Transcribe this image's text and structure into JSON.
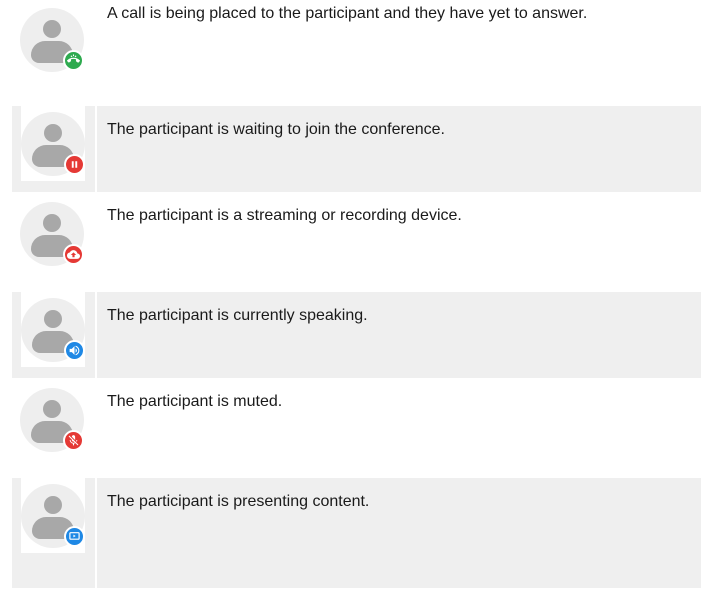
{
  "colors": {
    "row_shaded": "#efefef",
    "avatar_bg": "#eeeeee",
    "avatar_figure": "#a8a8a8",
    "badge_green": "#2eaa4f",
    "badge_red": "#e53935",
    "badge_blue": "#1e88e5"
  },
  "rows": [
    {
      "description": "A call is being placed to the participant and they have yet to answer.",
      "badge_icon": "ringing-phone-icon",
      "badge_color": "#2eaa4f",
      "shaded": false
    },
    {
      "description": "The participant is waiting to join the conference.",
      "badge_icon": "pause-icon",
      "badge_color": "#e53935",
      "shaded": true
    },
    {
      "description": "The participant is a streaming or recording device.",
      "badge_icon": "cloud-upload-icon",
      "badge_color": "#e53935",
      "shaded": false
    },
    {
      "description": "The participant is currently speaking.",
      "badge_icon": "speaker-icon",
      "badge_color": "#1e88e5",
      "shaded": true
    },
    {
      "description": "The participant is muted.",
      "badge_icon": "mic-off-icon",
      "badge_color": "#e53935",
      "shaded": false
    },
    {
      "description": "The participant is presenting content.",
      "badge_icon": "presentation-icon",
      "badge_color": "#1e88e5",
      "shaded": true
    }
  ]
}
